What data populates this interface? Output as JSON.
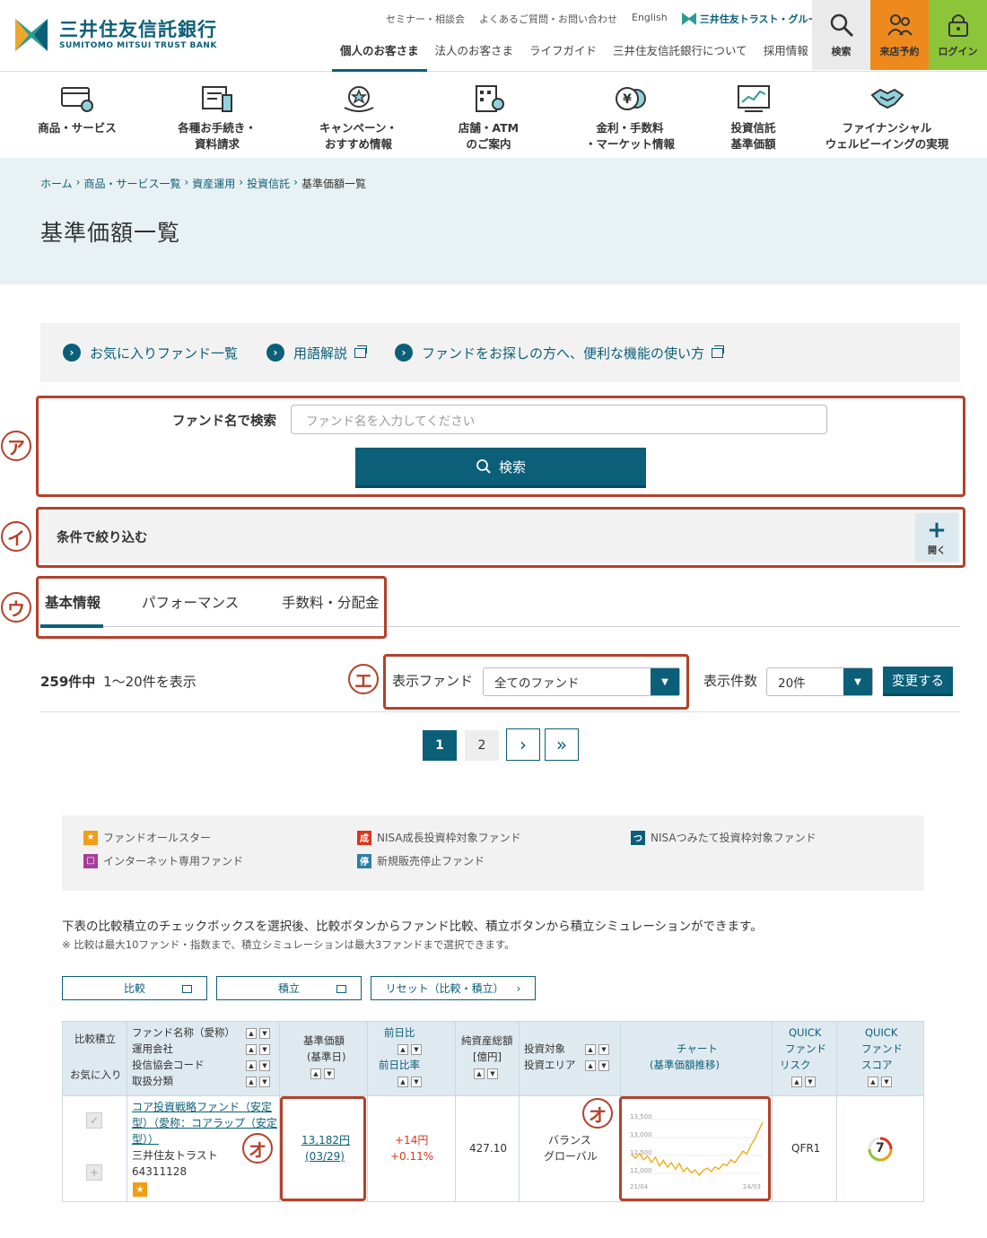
{
  "header": {
    "logo_jp": "三井住友信託銀行",
    "logo_en": "SUMITOMO MITSUI TRUST BANK",
    "util_links": [
      "セミナー・相談会",
      "よくあるご質問・お問い合わせ",
      "English"
    ],
    "group_logo": "三井住友トラスト・グループ",
    "main_nav": [
      "個人のお客さま",
      "法人のお客さま",
      "ライフガイド",
      "三井住友信託銀行について",
      "採用情報"
    ],
    "btn_search": "検索",
    "btn_visit": "来店予約",
    "btn_login": "ログイン"
  },
  "category_nav": [
    {
      "line1": "商品・サービス",
      "line2": "",
      "icon": "card-icon"
    },
    {
      "line1": "各種お手続き・",
      "line2": "資料請求",
      "icon": "document-icon"
    },
    {
      "line1": "キャンペーン・",
      "line2": "おすすめ情報",
      "icon": "campaign-icon"
    },
    {
      "line1": "店舗・ATM",
      "line2": "のご案内",
      "icon": "store-icon"
    },
    {
      "line1": "金利・手数料",
      "line2": "・マーケット情報",
      "icon": "yen-icon"
    },
    {
      "line1": "投資信託",
      "line2": "基準価額",
      "icon": "chart-icon"
    },
    {
      "line1": "ファイナンシャル",
      "line2": "ウェルビーイングの実現",
      "icon": "handshake-icon"
    }
  ],
  "breadcrumb": [
    "ホーム",
    "商品・サービス一覧",
    "資産運用",
    "投資信託",
    "基準価額一覧"
  ],
  "page_title": "基準価額一覧",
  "links_bar": [
    "お気に入りファンド一覧",
    "用語解説",
    "ファンドをお探しの方へ、便利な機能の使い方"
  ],
  "annotations": {
    "a": "ア",
    "i": "イ",
    "u": "ウ",
    "e": "エ",
    "o": "オ"
  },
  "search": {
    "label": "ファンド名で検索",
    "placeholder": "ファンド名を入力してください",
    "button": "検索"
  },
  "filter": {
    "label": "条件で絞り込む",
    "open_label": "開く",
    "plus": "+"
  },
  "tabs": [
    "基本情報",
    "パフォーマンス",
    "手数料・分配金"
  ],
  "results": {
    "total": "259件中",
    "range": "1～20件を表示",
    "display_fund_label": "表示ファンド",
    "display_fund_value": "全てのファンド",
    "display_count_label": "表示件数",
    "display_count_value": "20件",
    "change_button": "変更する"
  },
  "pagination": {
    "pages": [
      "1",
      "2"
    ],
    "next": "›",
    "last": "»"
  },
  "legend": {
    "allstar": {
      "badge": "★",
      "label": "ファンドオールスター",
      "color": "#f39d15"
    },
    "nisa_growth": {
      "badge": "成",
      "label": "NISA成長投資枠対象ファンド",
      "color": "#d9361e"
    },
    "nisa_tsumitate": {
      "badge": "つ",
      "label": "NISAつみたて投資枠対象ファンド",
      "color": "#0b5f78"
    },
    "internet": {
      "badge": "□",
      "label": "インターネット専用ファンド",
      "color": "#a63d9a"
    },
    "stopped": {
      "badge": "停",
      "label": "新規販売停止ファンド",
      "color": "#2e7fa3"
    }
  },
  "notes": {
    "main": "下表の比較積立のチェックボックスを選択後、比較ボタンからファンド比較、積立ボタンから積立シミュレーションができます。",
    "sub": "※ 比較は最大10ファンド・指数まで、積立シミュレーションは最大3ファンドまで選択できます。"
  },
  "actions": {
    "compare": "比較",
    "tsumitate": "積立",
    "reset": "リセット（比較・積立）"
  },
  "table": {
    "headers": {
      "compare": "比較積立",
      "favorite": "お気に入り",
      "fund": [
        "ファンド名称（愛称）",
        "運用会社",
        "投信協会コード",
        "取扱分類"
      ],
      "nav": [
        "基準価額",
        "(基準日)"
      ],
      "change": [
        "前日比",
        "前日比率"
      ],
      "assets": [
        "純資産総額",
        "[億円]"
      ],
      "target": [
        "投資対象",
        "投資エリア"
      ],
      "chart": [
        "チャート",
        "(基準価額推移)"
      ],
      "risk": [
        "QUICK",
        "ファンド",
        "リスク"
      ],
      "score": [
        "QUICK",
        "ファンド",
        "スコア"
      ]
    },
    "rows": [
      {
        "fund_name": [
          "コア投資戦略ファンド（安定",
          "型）（愛称：コアラップ（安定",
          "型））"
        ],
        "company": "三井住友トラスト",
        "code": "64311128",
        "nav": "13,182円",
        "nav_date": "(03/29)",
        "change": "+14円",
        "change_rate": "+0.11%",
        "assets": "427.10",
        "target": "バランス",
        "area": "グローバル",
        "risk": "QFR1",
        "score": "7"
      }
    ]
  },
  "chart_data": {
    "type": "line",
    "title": "",
    "xlabel": "",
    "ylabel": "",
    "y_ticks": [
      "13,500",
      "13,000",
      "12,500",
      "12,000"
    ],
    "x_ticks": [
      "21/04",
      "24/03"
    ],
    "ylim": [
      11900,
      13600
    ],
    "values": [
      12520,
      12420,
      12560,
      12380,
      12480,
      12310,
      12450,
      12210,
      12360,
      12180,
      12300,
      12120,
      12280,
      12050,
      12160,
      12020,
      12100,
      11950,
      12080,
      12150,
      12050,
      12180,
      12120,
      12260,
      12220,
      12380,
      12300,
      12460,
      12620,
      12540,
      12780,
      12960,
      13200,
      13420
    ],
    "color": "#f3a50b"
  },
  "colors": {
    "brand": "#0b5f78",
    "accent_orange": "#ee8a1d",
    "accent_green": "#8cc43a",
    "annot": "#b3412a"
  }
}
